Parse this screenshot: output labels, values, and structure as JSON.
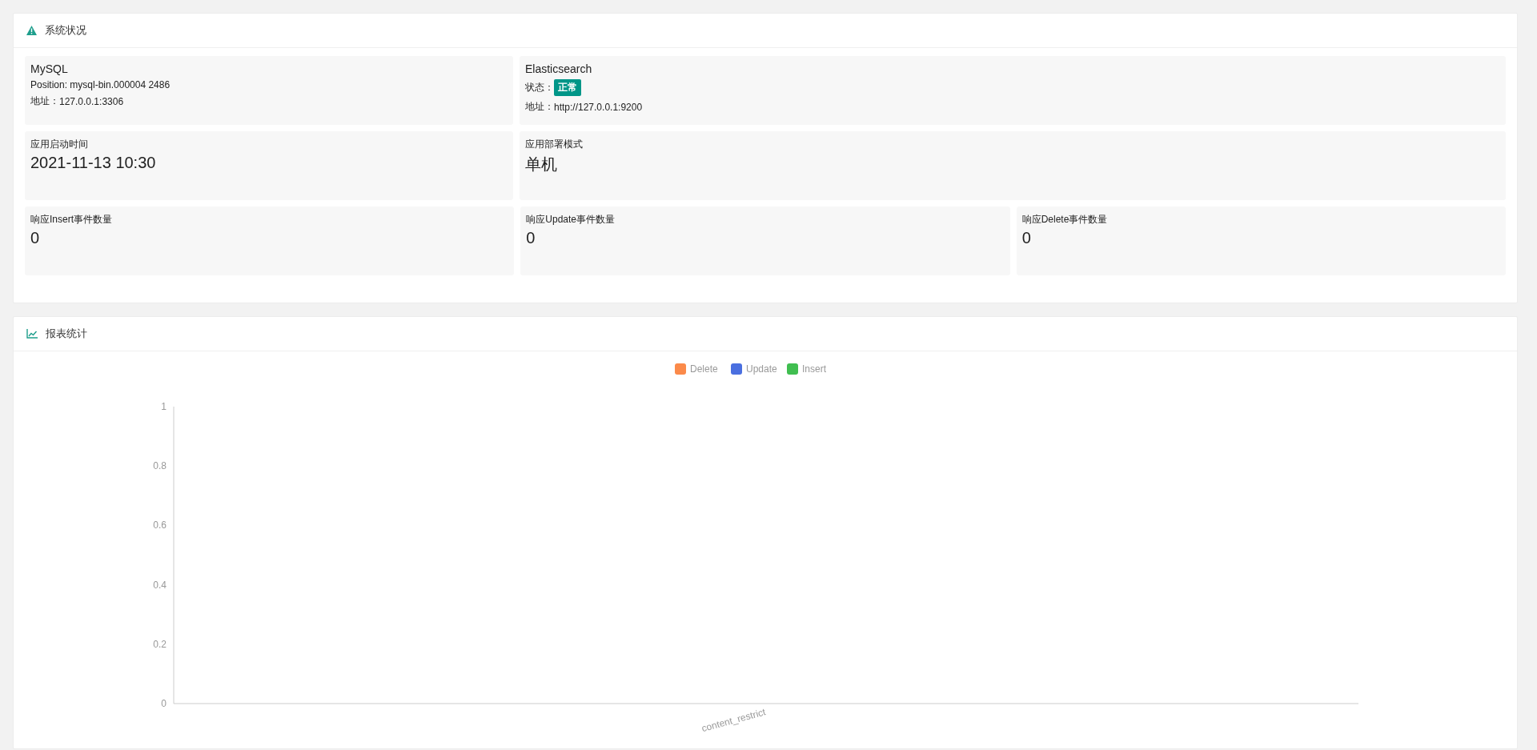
{
  "system_panel": {
    "title": "系统状况",
    "mysql": {
      "name": "MySQL",
      "position": "Position: mysql-bin.000004 2486",
      "address_label": "地址：",
      "address": "127.0.0.1:3306"
    },
    "elasticsearch": {
      "name": "Elasticsearch",
      "status_label": "状态：",
      "status": "正常",
      "address_label": "地址：",
      "address": "http://127.0.0.1:9200"
    },
    "stats_row_1": [
      {
        "label": "应用启动时间",
        "value": "2021-11-13 10:30"
      },
      {
        "label": "应用部署模式",
        "value": "单机"
      }
    ],
    "stats_row_2": [
      {
        "label": "响应Insert事件数量",
        "value": "0"
      },
      {
        "label": "响应Update事件数量",
        "value": "0"
      },
      {
        "label": "响应Delete事件数量",
        "value": "0"
      }
    ]
  },
  "report_panel": {
    "title": "报表统计",
    "chart_data": {
      "type": "bar",
      "categories": [
        "content_restrict"
      ],
      "series": [
        {
          "name": "Delete",
          "color": "#fb8a4a",
          "values": [
            0
          ]
        },
        {
          "name": "Update",
          "color": "#4a6fe0",
          "values": [
            0
          ]
        },
        {
          "name": "Insert",
          "color": "#40be50",
          "values": [
            0
          ]
        }
      ],
      "ylim": [
        0,
        1
      ],
      "yticks": [
        0,
        0.2,
        0.4,
        0.6,
        0.8,
        1
      ]
    }
  }
}
